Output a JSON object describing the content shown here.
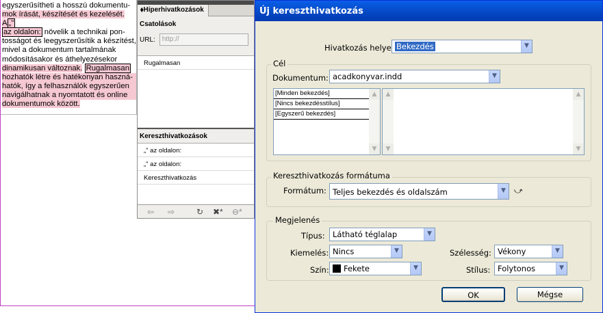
{
  "document": {
    "lines": [
      "egyszerűsítheti a hosszú dokumentu-",
      "mok írását, készítését és kezelését. A",
      "az oldalon:",
      " növelik a technikai pon-",
      "tosságot és leegyszerűsítik a készítést,",
      "mivel a dokumentum tartalmának",
      "módosításakor és áthelyezésekor",
      "dinamikusan változnak.",
      "Rugalmasan",
      "hozhatók létre és hatékonyan haszná-",
      "hatók, így a felhasználók egyszerűen",
      "navigálhatnak a nyomtatott és online",
      "dokumentumok között."
    ],
    "quote_mark": "„\""
  },
  "hyperlinks_panel": {
    "tab_label": "Hiperhivatkozások",
    "section_links": "Csatolások",
    "url_label": "URL:",
    "url_placeholder": "http://",
    "links": [
      "Rugalmasan"
    ],
    "section_crossrefs": "Kereszthivatkozások",
    "crossrefs": [
      "„\" az oldalon:",
      "„\" az oldalon:",
      "Kereszthivatkozás"
    ],
    "toolbar_icons": [
      "arrow-left-icon",
      "arrow-right-icon",
      "refresh-icon",
      "new-crossref-icon",
      "delete-link-icon"
    ]
  },
  "dialog": {
    "title": "Új kereszthivatkozás",
    "link_to_label": "Hivatkozás helye:",
    "link_to_value": "Bekezdés",
    "destination_group": "Cél",
    "document_label": "Dokumentum:",
    "document_value": "acadkonyvar.indd",
    "paragraph_styles": [
      "[Minden bekezdés]",
      "[Nincs bekezdésstílus]",
      "[Egyszerű bekezdés]"
    ],
    "format_group": "Kereszthivatkozás formátuma",
    "format_label": "Formátum:",
    "format_value": "Teljes bekezdés és oldalszám",
    "appearance_group": "Megjelenés",
    "type_label": "Típus:",
    "type_value": "Látható téglalap",
    "highlight_label": "Kiemelés:",
    "highlight_value": "Nincs",
    "width_label": "Szélesség:",
    "width_value": "Vékony",
    "color_label": "Szín:",
    "color_value": "Fekete",
    "style_label": "Stílus:",
    "style_value": "Folytonos",
    "ok_label": "OK",
    "cancel_label": "Mégse"
  }
}
